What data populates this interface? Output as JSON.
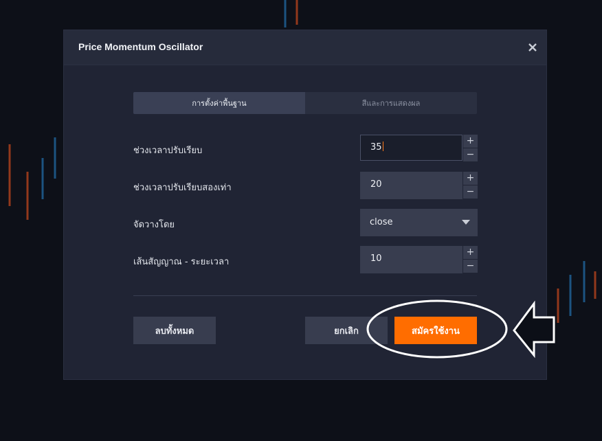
{
  "dialog": {
    "title": "Price Momentum Oscillator",
    "close_icon": "close-icon"
  },
  "tabs": [
    {
      "label": "การตั้งค่าพื้นฐาน",
      "active": true
    },
    {
      "label": "สีและการแสดงผล",
      "active": false
    }
  ],
  "fields": {
    "smoothing_period": {
      "label": "ช่วงเวลาปรับเรียบ",
      "value": "35"
    },
    "double_smoothing_period": {
      "label": "ช่วงเวลาปรับเรียบสองเท่า",
      "value": "20"
    },
    "source": {
      "label": "จัดวางโดย",
      "value": "close"
    },
    "signal_period": {
      "label": "เส้นสัญญาณ - ระยะเวลา",
      "value": "10"
    }
  },
  "stepper": {
    "plus": "+",
    "minus": "−"
  },
  "buttons": {
    "reset": "ลบทั้งหมด",
    "cancel": "ยกเลิก",
    "apply": "สมัครใช้งาน"
  },
  "colors": {
    "accent": "#ff6d00",
    "dialog_bg": "#202434",
    "field_bg": "#383d4f"
  }
}
